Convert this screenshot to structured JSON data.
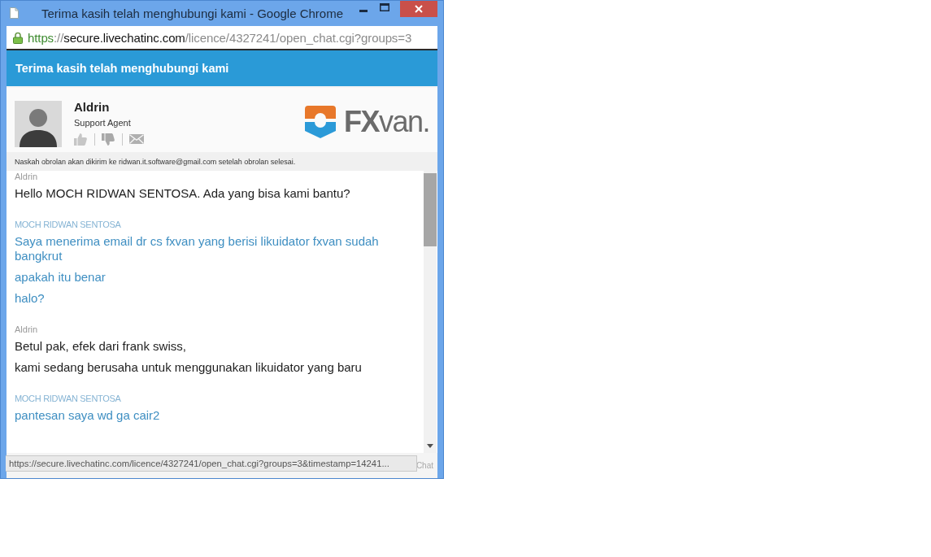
{
  "window": {
    "title": "Terima kasih telah menghubungi kami - Google Chrome"
  },
  "address_bar": {
    "secure": true,
    "parts": [
      {
        "text": "https",
        "kind": "scheme"
      },
      {
        "text": "://",
        "kind": "separator"
      },
      {
        "text": "secure.livechatinc.com",
        "kind": "host"
      },
      {
        "text": "/licence/4327241/open_chat.cgi?groups=3",
        "kind": "path"
      }
    ]
  },
  "chat_header": {
    "title": "Terima kasih telah menghubungi kami"
  },
  "agent": {
    "name": "Aldrin",
    "role": "Support Agent"
  },
  "logo": {
    "text": "**FX**van."
  },
  "transcript_notice": "Naskah obrolan akan dikirim ke ridwan.it.software@gmail.com setelah obrolan selesai.",
  "transcript": [
    {
      "sender": "Aldrin",
      "kind": "agent",
      "messages": [
        "Hello MOCH RIDWAN SENTOSA. Ada yang bisa kami bantu?"
      ]
    },
    {
      "sender": "MOCH RIDWAN SENTOSA",
      "kind": "visitor",
      "messages": [
        "Saya menerima email dr cs fxvan yang berisi likuidator fxvan sudah bangkrut",
        "apakah itu benar",
        "halo?"
      ]
    },
    {
      "sender": "Aldrin",
      "kind": "agent",
      "messages": [
        "Betul pak, efek dari frank swiss,",
        "kami sedang berusaha untuk menggunakan likuidator yang baru"
      ]
    },
    {
      "sender": "MOCH RIDWAN SENTOSA",
      "kind": "visitor",
      "messages": [
        "pantesan saya wd ga cair2"
      ]
    }
  ],
  "footer_label": "Chat",
  "status_bubble": "https://secure.livechatinc.com/licence/4327241/open_chat.cgi?groups=3&timestamp=14241..."
}
